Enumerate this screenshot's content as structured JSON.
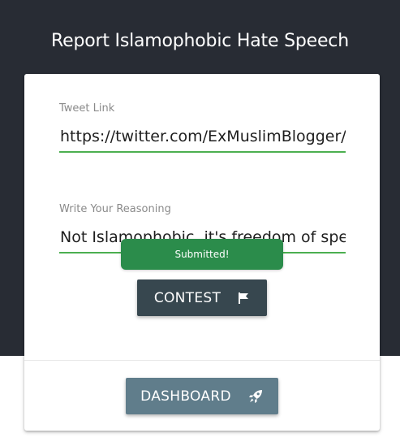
{
  "page": {
    "title": "Report Islamophobic Hate Speech"
  },
  "form": {
    "tweet_label": "Tweet Link",
    "tweet_value": "https://twitter.com/ExMuslimBlogger/sta",
    "reason_label": "Write Your Reasoning",
    "reason_value": "Not Islamophobic, it's freedom of speec"
  },
  "toast": {
    "message": "Submitted!"
  },
  "buttons": {
    "contest_label": "CONTEST",
    "contest_icon": "flag-icon",
    "dashboard_label": "DASHBOARD",
    "dashboard_icon": "rocket-icon"
  },
  "colors": {
    "header_bg": "#282c34",
    "input_underline": "#4caf50",
    "toast_bg": "#2b8c4b",
    "contest_bg": "#37474f",
    "dashboard_bg": "#607d8b"
  }
}
